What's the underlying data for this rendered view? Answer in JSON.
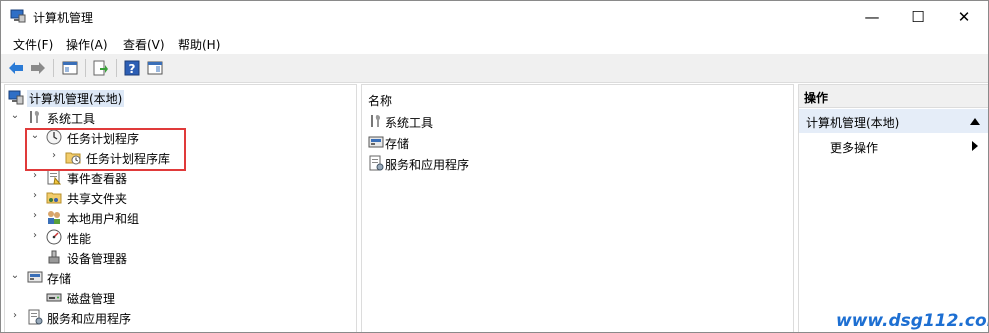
{
  "window": {
    "title": "计算机管理"
  },
  "window_controls": {
    "minimize": "—",
    "maximize": "☐",
    "close": "✕"
  },
  "menu": [
    "文件(F)",
    "操作(A)",
    "查看(V)",
    "帮助(H)"
  ],
  "tree": {
    "root": "计算机管理(本地)",
    "system_tools": "系统工具",
    "task_scheduler": "任务计划程序",
    "task_scheduler_library": "任务计划程序库",
    "event_viewer": "事件查看器",
    "shared_folders": "共享文件夹",
    "local_users": "本地用户和组",
    "performance": "性能",
    "device_manager": "设备管理器",
    "storage": "存储",
    "disk_management": "磁盘管理",
    "services_apps": "服务和应用程序"
  },
  "list": {
    "header": "名称",
    "items": [
      "系统工具",
      "存储",
      "服务和应用程序"
    ]
  },
  "actions": {
    "header": "操作",
    "selected": "计算机管理(本地)",
    "more": "更多操作"
  },
  "watermark": "www.dsg112.com"
}
